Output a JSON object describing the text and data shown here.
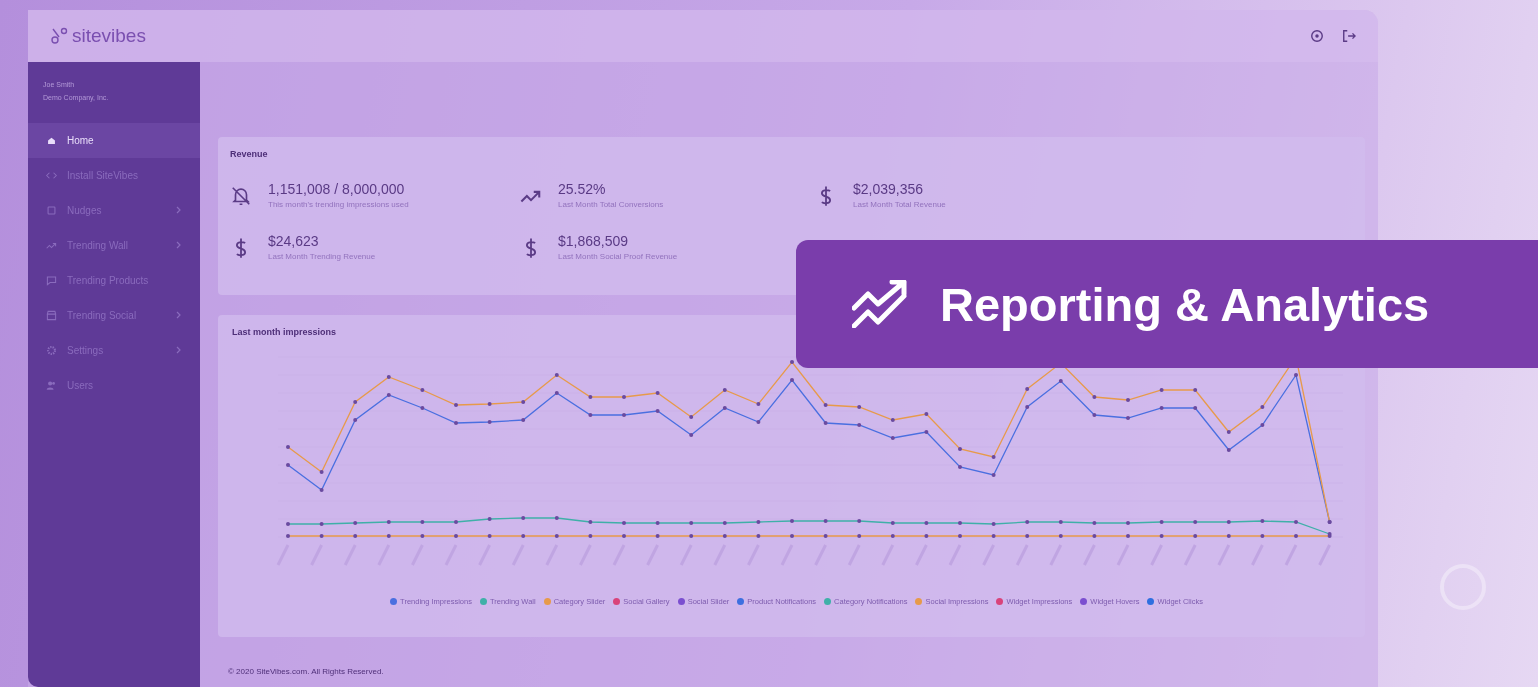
{
  "topbar": {
    "logo": "sitevibes"
  },
  "sidebar": {
    "user_name": "Joe Smith",
    "company": "Demo Company, Inc.",
    "items": [
      {
        "label": "Home",
        "kind": "home",
        "selected": true,
        "has_submenu": false
      },
      {
        "label": "Install SiteVibes",
        "kind": "code",
        "selected": false,
        "has_submenu": false
      },
      {
        "label": "Nudges",
        "kind": "square",
        "selected": false,
        "has_submenu": true
      },
      {
        "label": "Trending Wall",
        "kind": "trend",
        "selected": false,
        "has_submenu": true
      },
      {
        "label": "Trending Products",
        "kind": "tag",
        "selected": false,
        "has_submenu": false
      },
      {
        "label": "Trending Social",
        "kind": "store",
        "selected": false,
        "has_submenu": true
      },
      {
        "label": "Settings",
        "kind": "gear",
        "selected": false,
        "has_submenu": true
      },
      {
        "label": "Users",
        "kind": "users",
        "selected": false,
        "has_submenu": false
      }
    ]
  },
  "revenue": {
    "title": "Revenue",
    "stats": [
      {
        "kind": "bell-off",
        "value": "1,151,008 / 8,000,000",
        "label": "This month's trending impressions used"
      },
      {
        "kind": "trend",
        "value": "25.52%",
        "label": "Last Month Total Conversions"
      },
      {
        "kind": "dollar",
        "value": "$2,039,356",
        "label": "Last Month Total Revenue"
      },
      {
        "kind": "dollar",
        "value": "$24,623",
        "label": "Last Month Trending Revenue"
      },
      {
        "kind": "dollar",
        "value": "$1,868,509",
        "label": "Last Month Social Proof Revenue"
      }
    ]
  },
  "impressions": {
    "title": "Last month impressions",
    "legend": [
      {
        "label": "Trending Impressions",
        "color": "#4a6fe0"
      },
      {
        "label": "Trending Wall",
        "color": "#3fb0a8"
      },
      {
        "label": "Category Slider",
        "color": "#e79a4a"
      },
      {
        "label": "Social Gallery",
        "color": "#d9437a"
      },
      {
        "label": "Social Slider",
        "color": "#7b4fd0"
      },
      {
        "label": "Product Notifications",
        "color": "#3d6fe0"
      },
      {
        "label": "Category Notifications",
        "color": "#3fb0a8"
      },
      {
        "label": "Social Impressions",
        "color": "#e79a4a"
      },
      {
        "label": "Widget Impressions",
        "color": "#d9437a"
      },
      {
        "label": "Widget Hovers",
        "color": "#7b4fd0"
      },
      {
        "label": "Widget Clicks",
        "color": "#2f6fe0"
      }
    ]
  },
  "banner": {
    "title": "Reporting & Analytics"
  },
  "footer": "© 2020 SiteVibes.com. All Rights Reserved."
}
